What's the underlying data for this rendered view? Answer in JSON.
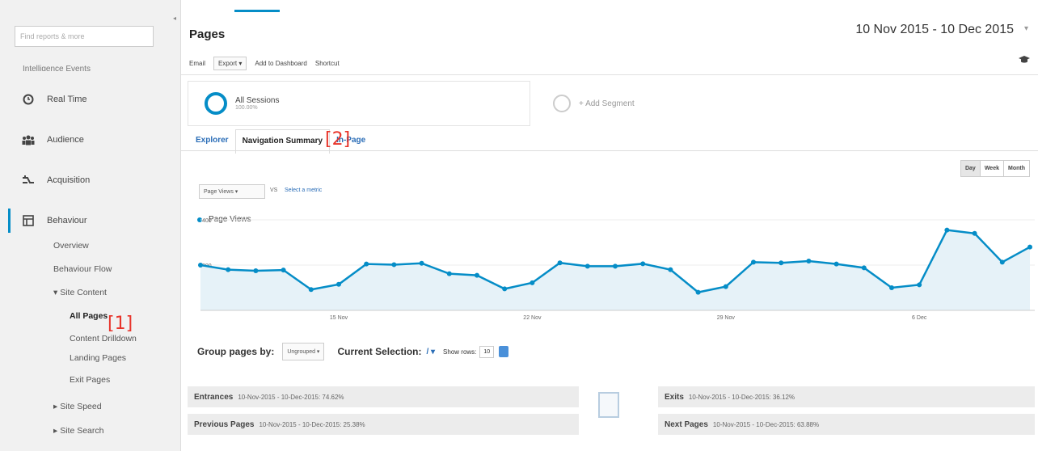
{
  "sidebar": {
    "search_placeholder": "Find reports & more",
    "cut_item": "Intelligence Events",
    "nav": [
      {
        "label": "Real Time",
        "icon": "clock-icon"
      },
      {
        "label": "Audience",
        "icon": "people-icon"
      },
      {
        "label": "Acquisition",
        "icon": "acquisition-icon"
      },
      {
        "label": "Behaviour",
        "icon": "behaviour-icon"
      }
    ],
    "behaviour_items": [
      "Overview",
      "Behaviour Flow",
      "▾ Site Content"
    ],
    "site_content_items": [
      "All Pages",
      "Content Drilldown",
      "Landing Pages",
      "Exit Pages"
    ],
    "more_items": [
      "▸ Site Speed",
      "▸ Site Search"
    ],
    "marker_1": "[1]"
  },
  "header": {
    "title": "Pages",
    "date_range": "10 Nov 2015 - 10 Dec 2015",
    "toolbar": {
      "email": "Email",
      "export": "Export ▾",
      "add_to_dashboard": "Add to Dashboard",
      "shortcut": "Shortcut"
    }
  },
  "segments": {
    "all_sessions": "All Sessions",
    "all_sessions_pct": "100.00%",
    "add_segment": "+ Add Segment"
  },
  "tabs": [
    {
      "label": "Explorer"
    },
    {
      "label": "Navigation Summary"
    },
    {
      "label": "In-Page"
    }
  ],
  "marker_2": "[2]",
  "chart_controls": {
    "metric": "Page Views",
    "vs": "VS",
    "select_metric": "Select a metric",
    "grain": [
      "Day",
      "Week",
      "Month"
    ]
  },
  "chart_data": {
    "type": "line",
    "series": [
      {
        "name": "Page Views",
        "values": [
          200,
          180,
          175,
          178,
          92,
          115,
          205,
          202,
          208,
          162,
          155,
          95,
          122,
          210,
          195,
          195,
          206,
          180,
          80,
          105,
          213,
          210,
          218,
          205,
          188,
          100,
          113,
          355,
          340,
          213,
          280
        ]
      }
    ],
    "x": [
      "10 Nov",
      "11 Nov",
      "12 Nov",
      "13 Nov",
      "14 Nov",
      "15 Nov",
      "16 Nov",
      "17 Nov",
      "18 Nov",
      "19 Nov",
      "20 Nov",
      "21 Nov",
      "22 Nov",
      "23 Nov",
      "24 Nov",
      "25 Nov",
      "26 Nov",
      "27 Nov",
      "28 Nov",
      "29 Nov",
      "30 Nov",
      "1 Dec",
      "2 Dec",
      "3 Dec",
      "4 Dec",
      "5 Dec",
      "6 Dec",
      "7 Dec",
      "8 Dec",
      "9 Dec",
      "10 Dec"
    ],
    "x_tick_labels": [
      "15 Nov",
      "22 Nov",
      "29 Nov",
      "6 Dec"
    ],
    "y_tick_labels": [
      "400",
      "200"
    ],
    "ylim": [
      0,
      400
    ],
    "grid": true,
    "colors": {
      "line": "#058dc7",
      "fill": "#e6f2f8"
    }
  },
  "grouping": {
    "group_by_label": "Group pages by:",
    "group_by_value": "Ungrouped ▾",
    "current_selection_label": "Current Selection:",
    "current_selection_value": "/ ▾",
    "show_rows_label": "Show rows:",
    "show_rows_value": "10"
  },
  "flow": {
    "entrances_label": "Entrances",
    "entrances_value": "10-Nov-2015 - 10-Dec-2015: 74.62%",
    "previous_label": "Previous Pages",
    "previous_value": "10-Nov-2015 - 10-Dec-2015: 25.38%",
    "exits_label": "Exits",
    "exits_value": "10-Nov-2015 - 10-Dec-2015: 36.12%",
    "next_label": "Next Pages",
    "next_value": "10-Nov-2015 - 10-Dec-2015: 63.88%"
  }
}
